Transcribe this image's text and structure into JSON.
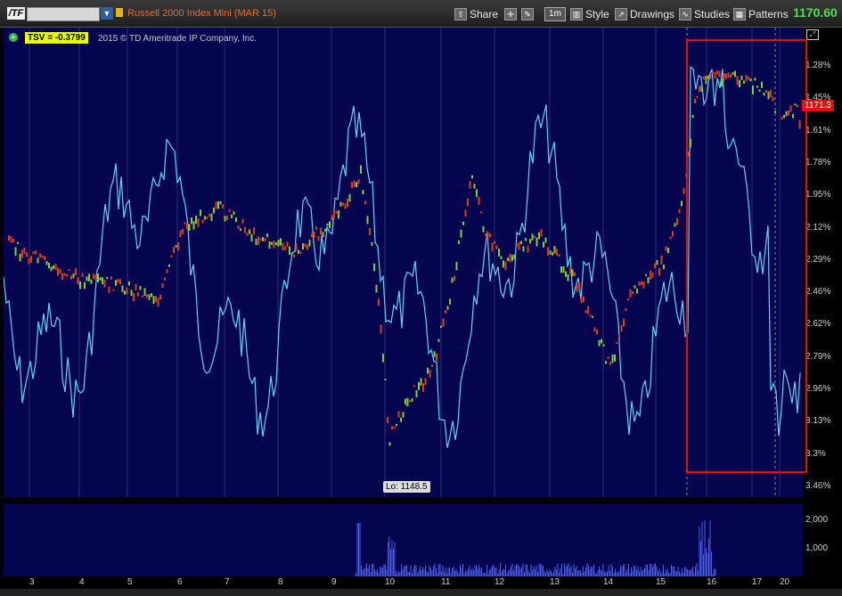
{
  "toolbar": {
    "symbol": "/TF",
    "title": "Russell 2000 Index Mini (MAR 15)",
    "share": "Share",
    "timeframe": "1m",
    "style": "Style",
    "drawings": "Drawings",
    "studies": "Studies",
    "patterns": "Patterns",
    "last_price": "1170.60"
  },
  "chart": {
    "study_label": "TSV  = -0.3799",
    "copyright": "2015 © TD Ameritrade IP Company, Inc.",
    "low_label": "Lo: 1148.5",
    "price_tag": "1171.3",
    "y_ticks": [
      "1.28%",
      "1.45%",
      "1.61%",
      "1.78%",
      "1.95%",
      "2.12%",
      "2.29%",
      "2.46%",
      "2.62%",
      "2.79%",
      "2.96%",
      "3.13%",
      "3.3%",
      "3.46%"
    ],
    "x_ticks": [
      "3",
      "4",
      "5",
      "6",
      "7",
      "8",
      "9",
      "10",
      "11",
      "12",
      "13",
      "14",
      "15",
      "16",
      "17",
      "20"
    ],
    "volume_ticks": [
      "2,000",
      "1,000"
    ]
  },
  "colors": {
    "background": "#05054f",
    "tsv_line": "#5fd3f5",
    "candle_up": "#7ad13a",
    "candle_down": "#e03a1a",
    "highlight_box": "#e01010"
  }
}
